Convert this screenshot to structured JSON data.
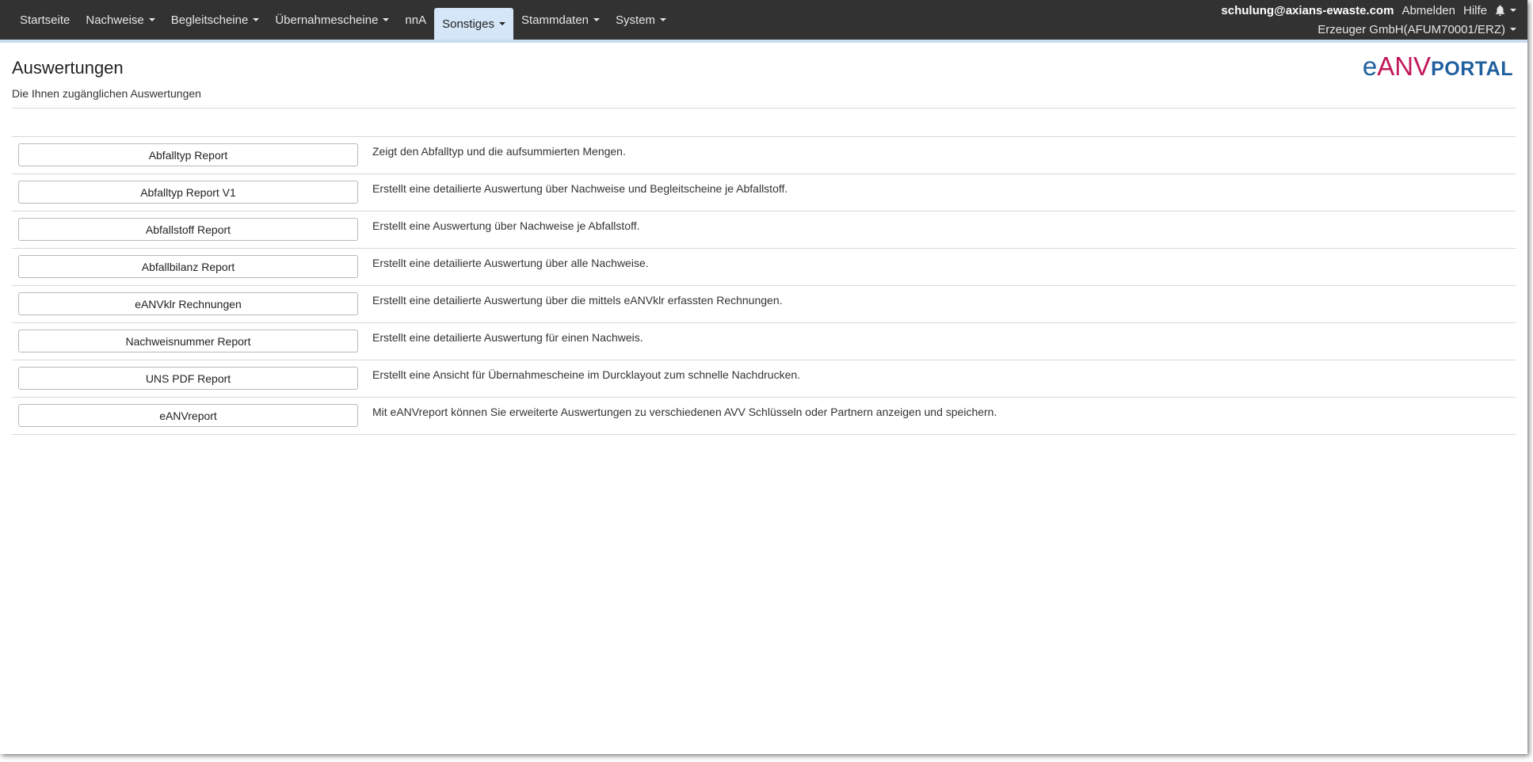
{
  "nav": {
    "items": [
      {
        "label": "Startseite",
        "caret": false
      },
      {
        "label": "Nachweise",
        "caret": true
      },
      {
        "label": "Begleitscheine",
        "caret": true
      },
      {
        "label": "Übernahmescheine",
        "caret": true
      },
      {
        "label": "nnA",
        "caret": false
      },
      {
        "label": "Sonstiges",
        "caret": true,
        "active": true
      },
      {
        "label": "Stammdaten",
        "caret": true
      },
      {
        "label": "System",
        "caret": true
      }
    ],
    "user_email": "schulung@axians-ewaste.com",
    "logout": "Abmelden",
    "help": "Hilfe",
    "notification_icon": "bell-icon",
    "company": "Erzeuger GmbH(AFUM70001/ERZ)"
  },
  "page": {
    "title": "Auswertungen",
    "subtitle": "Die Ihnen zugänglichen Auswertungen"
  },
  "logo": {
    "e": "e",
    "anv": "ANV",
    "portal": "PORTAL"
  },
  "colors": {
    "navbar_bg": "#323232",
    "active_tab_bg": "#d4e6f7",
    "logo_blue": "#1f5f9e",
    "logo_magenta": "#c2185b"
  },
  "reports": [
    {
      "label": "Abfalltyp Report",
      "description": "Zeigt den Abfalltyp und die aufsummierten Mengen."
    },
    {
      "label": "Abfalltyp Report V1",
      "description": "Erstellt eine detailierte Auswertung über Nachweise und Begleitscheine je Abfallstoff."
    },
    {
      "label": "Abfallstoff Report",
      "description": "Erstellt eine Auswertung über Nachweise je Abfallstoff."
    },
    {
      "label": "Abfallbilanz Report",
      "description": "Erstellt eine detailierte Auswertung über alle Nachweise."
    },
    {
      "label": "eANVklr Rechnungen",
      "description": "Erstellt eine detailierte Auswertung über die mittels eANVklr erfassten Rechnungen."
    },
    {
      "label": "Nachweisnummer Report",
      "description": "Erstellt eine detailierte Auswertung für einen Nachweis."
    },
    {
      "label": "UNS PDF Report",
      "description": "Erstellt eine Ansicht für Übernahmescheine im Durcklayout zum schnelle Nachdrucken."
    },
    {
      "label": "eANVreport",
      "description": "Mit eANVreport können Sie erweiterte Auswertungen zu verschiedenen AVV Schlüsseln oder Partnern anzeigen und speichern."
    }
  ]
}
